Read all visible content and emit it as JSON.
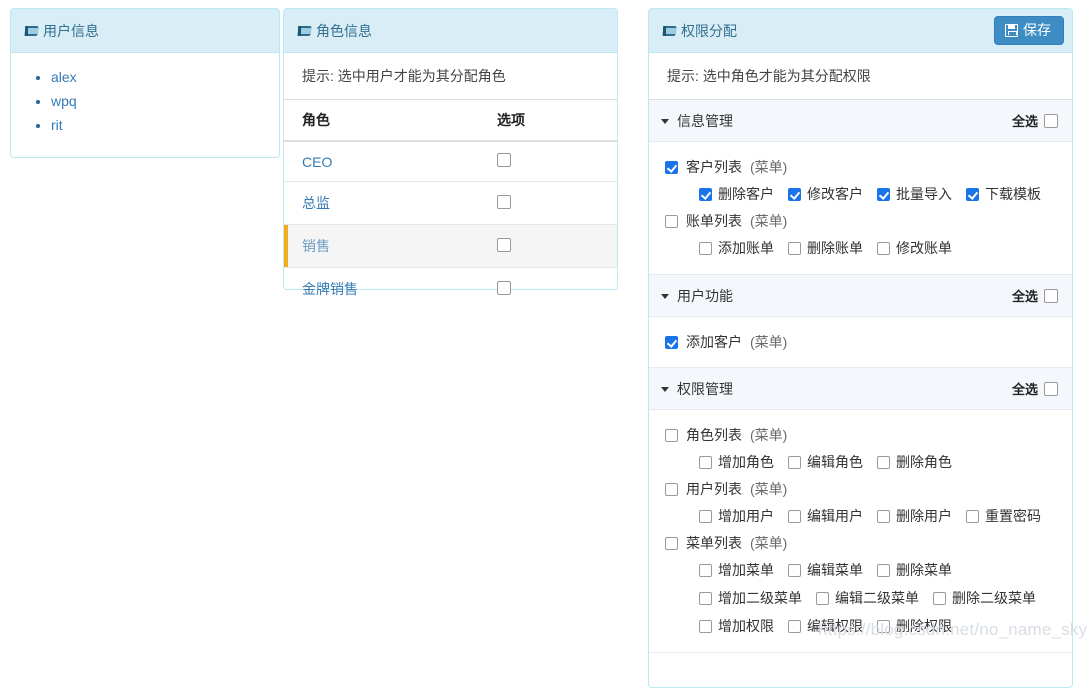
{
  "user_panel": {
    "title": "用户信息",
    "icon": "book-icon",
    "users": [
      {
        "name": "alex"
      },
      {
        "name": "wpq"
      },
      {
        "name": "rit"
      }
    ]
  },
  "role_panel": {
    "title": "角色信息",
    "icon": "book-icon",
    "tip": "提示: 选中用户才能为其分配角色",
    "columns": [
      "角色",
      "选项"
    ],
    "rows": [
      {
        "name": "CEO",
        "checked": false,
        "selected": false
      },
      {
        "name": "总监",
        "checked": false,
        "selected": false
      },
      {
        "name": "销售",
        "checked": false,
        "selected": true
      },
      {
        "name": "金牌销售",
        "checked": false,
        "selected": false
      }
    ]
  },
  "perm_panel": {
    "title": "权限分配",
    "icon": "book-icon",
    "save_label": "保存",
    "save_icon": "save-icon",
    "tip": "提示: 选中角色才能为其分配权限",
    "select_all_label": "全选",
    "menu_tag": "(菜单)",
    "groups": [
      {
        "name": "信息管理",
        "select_all": false,
        "items": [
          {
            "label": "客户列表",
            "tag": "(菜单)",
            "checked": true,
            "children": [
              {
                "label": "删除客户",
                "checked": true
              },
              {
                "label": "修改客户",
                "checked": true
              },
              {
                "label": "批量导入",
                "checked": true
              },
              {
                "label": "下载模板",
                "checked": true
              }
            ]
          },
          {
            "label": "账单列表",
            "tag": "(菜单)",
            "checked": false,
            "children": [
              {
                "label": "添加账单",
                "checked": false
              },
              {
                "label": "删除账单",
                "checked": false
              },
              {
                "label": "修改账单",
                "checked": false
              }
            ]
          }
        ]
      },
      {
        "name": "用户功能",
        "select_all": false,
        "items": [
          {
            "label": "添加客户",
            "tag": "(菜单)",
            "checked": true,
            "children": []
          }
        ]
      },
      {
        "name": "权限管理",
        "select_all": false,
        "items": [
          {
            "label": "角色列表",
            "tag": "(菜单)",
            "checked": false,
            "children": [
              {
                "label": "增加角色",
                "checked": false
              },
              {
                "label": "编辑角色",
                "checked": false
              },
              {
                "label": "删除角色",
                "checked": false
              }
            ]
          },
          {
            "label": "用户列表",
            "tag": "(菜单)",
            "checked": false,
            "children": [
              {
                "label": "增加用户",
                "checked": false
              },
              {
                "label": "编辑用户",
                "checked": false
              },
              {
                "label": "删除用户",
                "checked": false
              },
              {
                "label": "重置密码",
                "checked": false
              }
            ]
          },
          {
            "label": "菜单列表",
            "tag": "(菜单)",
            "checked": false,
            "children": [
              {
                "label": "增加菜单",
                "checked": false
              },
              {
                "label": "编辑菜单",
                "checked": false
              },
              {
                "label": "删除菜单",
                "checked": false
              }
            ],
            "children2": [
              {
                "label": "增加二级菜单",
                "checked": false
              },
              {
                "label": "编辑二级菜单",
                "checked": false
              },
              {
                "label": "删除二级菜单",
                "checked": false
              }
            ],
            "children3": [
              {
                "label": "增加权限",
                "checked": false
              },
              {
                "label": "编辑权限",
                "checked": false
              },
              {
                "label": "删除权限",
                "checked": false
              }
            ]
          }
        ]
      }
    ]
  },
  "watermark": "https://blog.csdn.net/no_name_sky",
  "colors": {
    "panel_header_bg": "#d9edf7",
    "panel_border": "#bce8f1",
    "title_text": "#31708f",
    "link": "#337ab7",
    "save_button": "#3d8dc4",
    "checkbox_checked": "#1a73e8",
    "selected_row_accent": "#f0ad20",
    "selected_row_bg": "#f5f5f5",
    "group_header_bg": "#f4f8fc",
    "watermark": "#d8dde3"
  }
}
